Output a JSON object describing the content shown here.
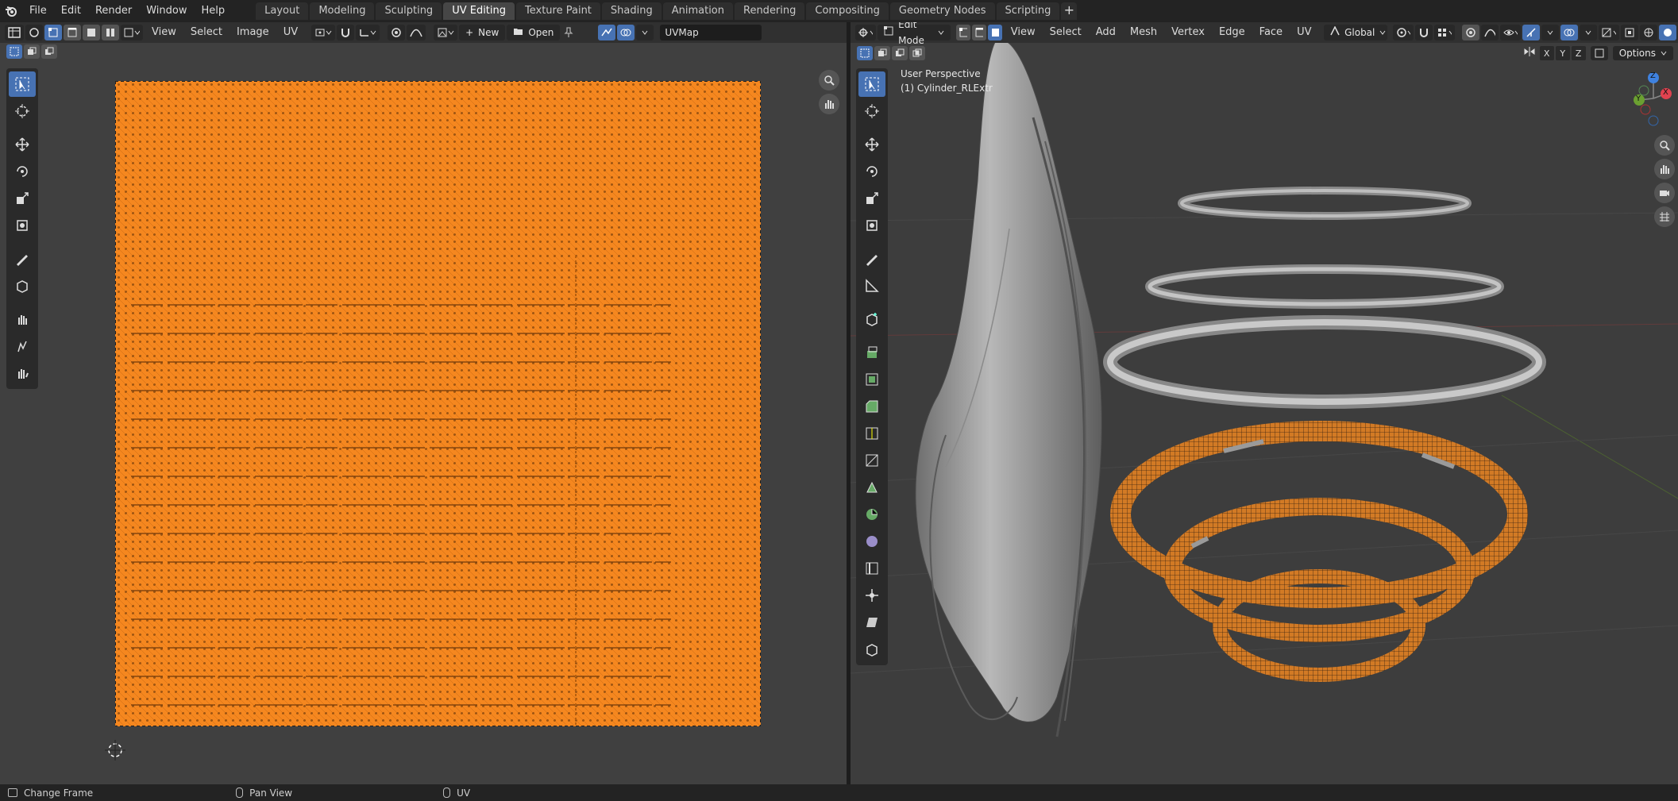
{
  "topbar": {
    "menus": [
      "File",
      "Edit",
      "Render",
      "Window",
      "Help"
    ],
    "workspaces": [
      "Layout",
      "Modeling",
      "Sculpting",
      "UV Editing",
      "Texture Paint",
      "Shading",
      "Animation",
      "Rendering",
      "Compositing",
      "Geometry Nodes",
      "Scripting"
    ],
    "active_workspace": "UV Editing",
    "add_tab": "+"
  },
  "uv_editor": {
    "menus": [
      "View",
      "Select",
      "Image",
      "UV"
    ],
    "new_label": "New",
    "open_label": "Open",
    "uvmap_field": "UVMap",
    "mesh_color": "#f5871f"
  },
  "viewport": {
    "mode": "Edit Mode",
    "menus": [
      "View",
      "Select",
      "Add",
      "Mesh",
      "Vertex",
      "Edge",
      "Face",
      "UV"
    ],
    "orientation": "Global",
    "options_label": "Options",
    "axis_buttons": [
      "X",
      "Y",
      "Z"
    ],
    "perspective_label": "User Perspective",
    "object_label": "(1) Cylinder_RLExtr",
    "gizmo": {
      "x": "X",
      "y": "Y",
      "z": "Z"
    }
  },
  "statusbar": {
    "items": [
      "Change Frame",
      "Pan View",
      "UV"
    ]
  },
  "colors": {
    "accent": "#4772b3",
    "selection_orange": "#f5871f",
    "axis_x": "#e0424f",
    "axis_y": "#6ba031",
    "axis_z": "#3f82e0"
  }
}
